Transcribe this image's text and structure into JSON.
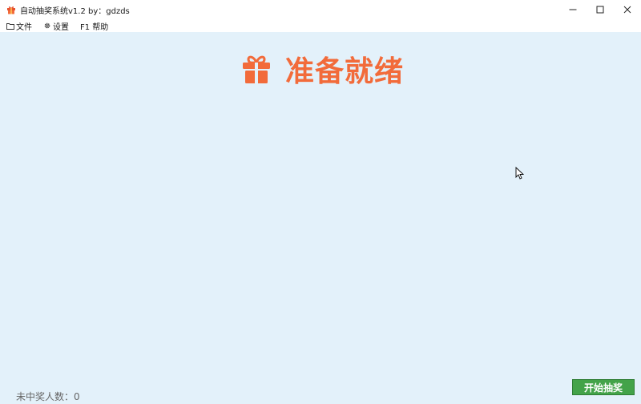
{
  "window": {
    "title": "自动抽奖系统v1.2  by：gdzds",
    "controls": {
      "minimize_icon": "minimize-icon",
      "maximize_icon": "maximize-icon",
      "close_icon": "close-icon"
    }
  },
  "menu": {
    "items": [
      {
        "label": "文件",
        "icon": "folder-icon"
      },
      {
        "label": "设置",
        "icon": "gear-icon"
      },
      {
        "label": "F1 帮助",
        "icon": ""
      }
    ]
  },
  "main": {
    "status": "准备就绪",
    "status_icon": "gift-icon",
    "status_color": "#f26b3a",
    "background_color": "#e3f1fa"
  },
  "footer": {
    "count_label": "未中奖人数：0",
    "start_button_label": "开始抽奖",
    "start_button_color": "#43a349"
  }
}
